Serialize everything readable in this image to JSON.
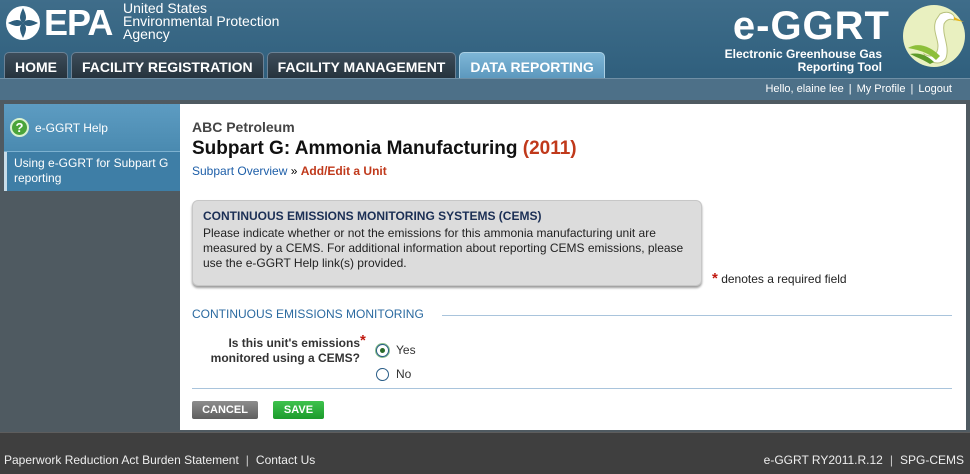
{
  "header": {
    "epa_letters": "EPA",
    "agency_line1": "United States",
    "agency_line2": "Environmental Protection",
    "agency_line3": "Agency",
    "app_title": "e-GGRT",
    "app_subtitle_line1": "Electronic Greenhouse Gas",
    "app_subtitle_line2": "Reporting Tool"
  },
  "tabs": [
    {
      "label": "HOME",
      "active": false
    },
    {
      "label": "FACILITY REGISTRATION",
      "active": false
    },
    {
      "label": "FACILITY MANAGEMENT",
      "active": false
    },
    {
      "label": "DATA REPORTING",
      "active": true
    }
  ],
  "userbar": {
    "greeting": "Hello, elaine lee",
    "my_profile": "My Profile",
    "logout": "Logout"
  },
  "sidebar": {
    "help_label": "e-GGRT Help",
    "help_link": "Using e-GGRT for Subpart G reporting"
  },
  "main": {
    "company": "ABC Petroleum",
    "title": "Subpart G: Ammonia Manufacturing",
    "year": "(2011)",
    "crumb_link": "Subpart Overview",
    "crumb_sep": "»",
    "crumb_current": "Add/Edit a Unit",
    "info_title": "CONTINUOUS EMISSIONS MONITORING SYSTEMS (CEMS)",
    "info_text": "Please indicate whether or not the emissions for this ammonia manufacturing unit are measured by a CEMS. For additional information about reporting CEMS emissions, please use the e-GGRT Help link(s) provided.",
    "required_star": "*",
    "required_note": "denotes a required field",
    "section_title": "CONTINUOUS EMISSIONS MONITORING",
    "question": "Is this unit's emissions monitored using a CEMS?",
    "options": [
      {
        "label": "Yes",
        "checked": true
      },
      {
        "label": "No",
        "checked": false
      }
    ],
    "cancel_label": "CANCEL",
    "save_label": "SAVE"
  },
  "footer": {
    "paperwork": "Paperwork Reduction Act Burden Statement",
    "contact": "Contact Us",
    "version": "e-GGRT RY2011.R.12",
    "page_code": "SPG-CEMS"
  }
}
